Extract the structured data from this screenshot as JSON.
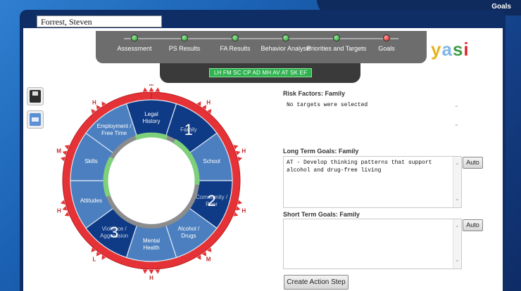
{
  "window": {
    "title": "Goals"
  },
  "client": {
    "name": "Forrest, Steven"
  },
  "steps": [
    {
      "label": "Assessment",
      "status": "green"
    },
    {
      "label": "PS Results",
      "status": "green"
    },
    {
      "label": "FA Results",
      "status": "green"
    },
    {
      "label": "Behavior Analysis",
      "status": "green"
    },
    {
      "label": "Priorities and Targets",
      "status": "green"
    },
    {
      "label": "Goals",
      "status": "red"
    }
  ],
  "domain_codes": "LH FM SC CP AD MH AV AT SK EF",
  "logo": {
    "text": "yasi",
    "colors": [
      "#e8b21c",
      "#7fb6e6",
      "#3f9b46",
      "#e0252b"
    ]
  },
  "wheel": {
    "segments": [
      {
        "label_lines": [
          "Legal",
          "History"
        ],
        "number": "",
        "selected": true
      },
      {
        "label_lines": [
          "Family"
        ],
        "number": "1",
        "selected": true
      },
      {
        "label_lines": [
          "School"
        ],
        "number": "",
        "selected": false
      },
      {
        "label_lines": [
          "Community /",
          "Peer"
        ],
        "number": "2",
        "selected": true
      },
      {
        "label_lines": [
          "Alcohol /",
          "Drugs"
        ],
        "number": "",
        "selected": false
      },
      {
        "label_lines": [
          "Mental",
          "Health"
        ],
        "number": "",
        "selected": false
      },
      {
        "label_lines": [
          "Violence /",
          "Aggression"
        ],
        "number": "3",
        "selected": true
      },
      {
        "label_lines": [
          "Attitudes"
        ],
        "number": "",
        "selected": false
      },
      {
        "label_lines": [
          "Skills"
        ],
        "number": "",
        "selected": false
      },
      {
        "label_lines": [
          "Employment /",
          "Free Time"
        ],
        "number": "",
        "selected": false
      }
    ],
    "outer_levels": [
      "M",
      "H",
      "H",
      "H",
      "M",
      "H",
      "L",
      "H",
      "M",
      "H"
    ],
    "inner_levels": [
      "L",
      "L",
      "M",
      "N",
      "N",
      "L",
      "N",
      "L",
      "N",
      "L"
    ],
    "colors": {
      "selected": "#0e3a86",
      "normal": "#4b7fbf",
      "ring_red": "#e53236",
      "inner_green": "#7ed07a",
      "inner_gray": "#8c8c8c"
    }
  },
  "risk_factors": {
    "label": "Risk Factors: Family",
    "text": "No targets were selected"
  },
  "long_term_goals": {
    "label": "Long Term Goals: Family",
    "text": "AT - Develop thinking patterns that support alcohol and drug-free living",
    "button": "Auto"
  },
  "short_term_goals": {
    "label": "Short Term Goals: Family",
    "text": "",
    "button": "Auto"
  },
  "create_action_step": "Create Action Step"
}
